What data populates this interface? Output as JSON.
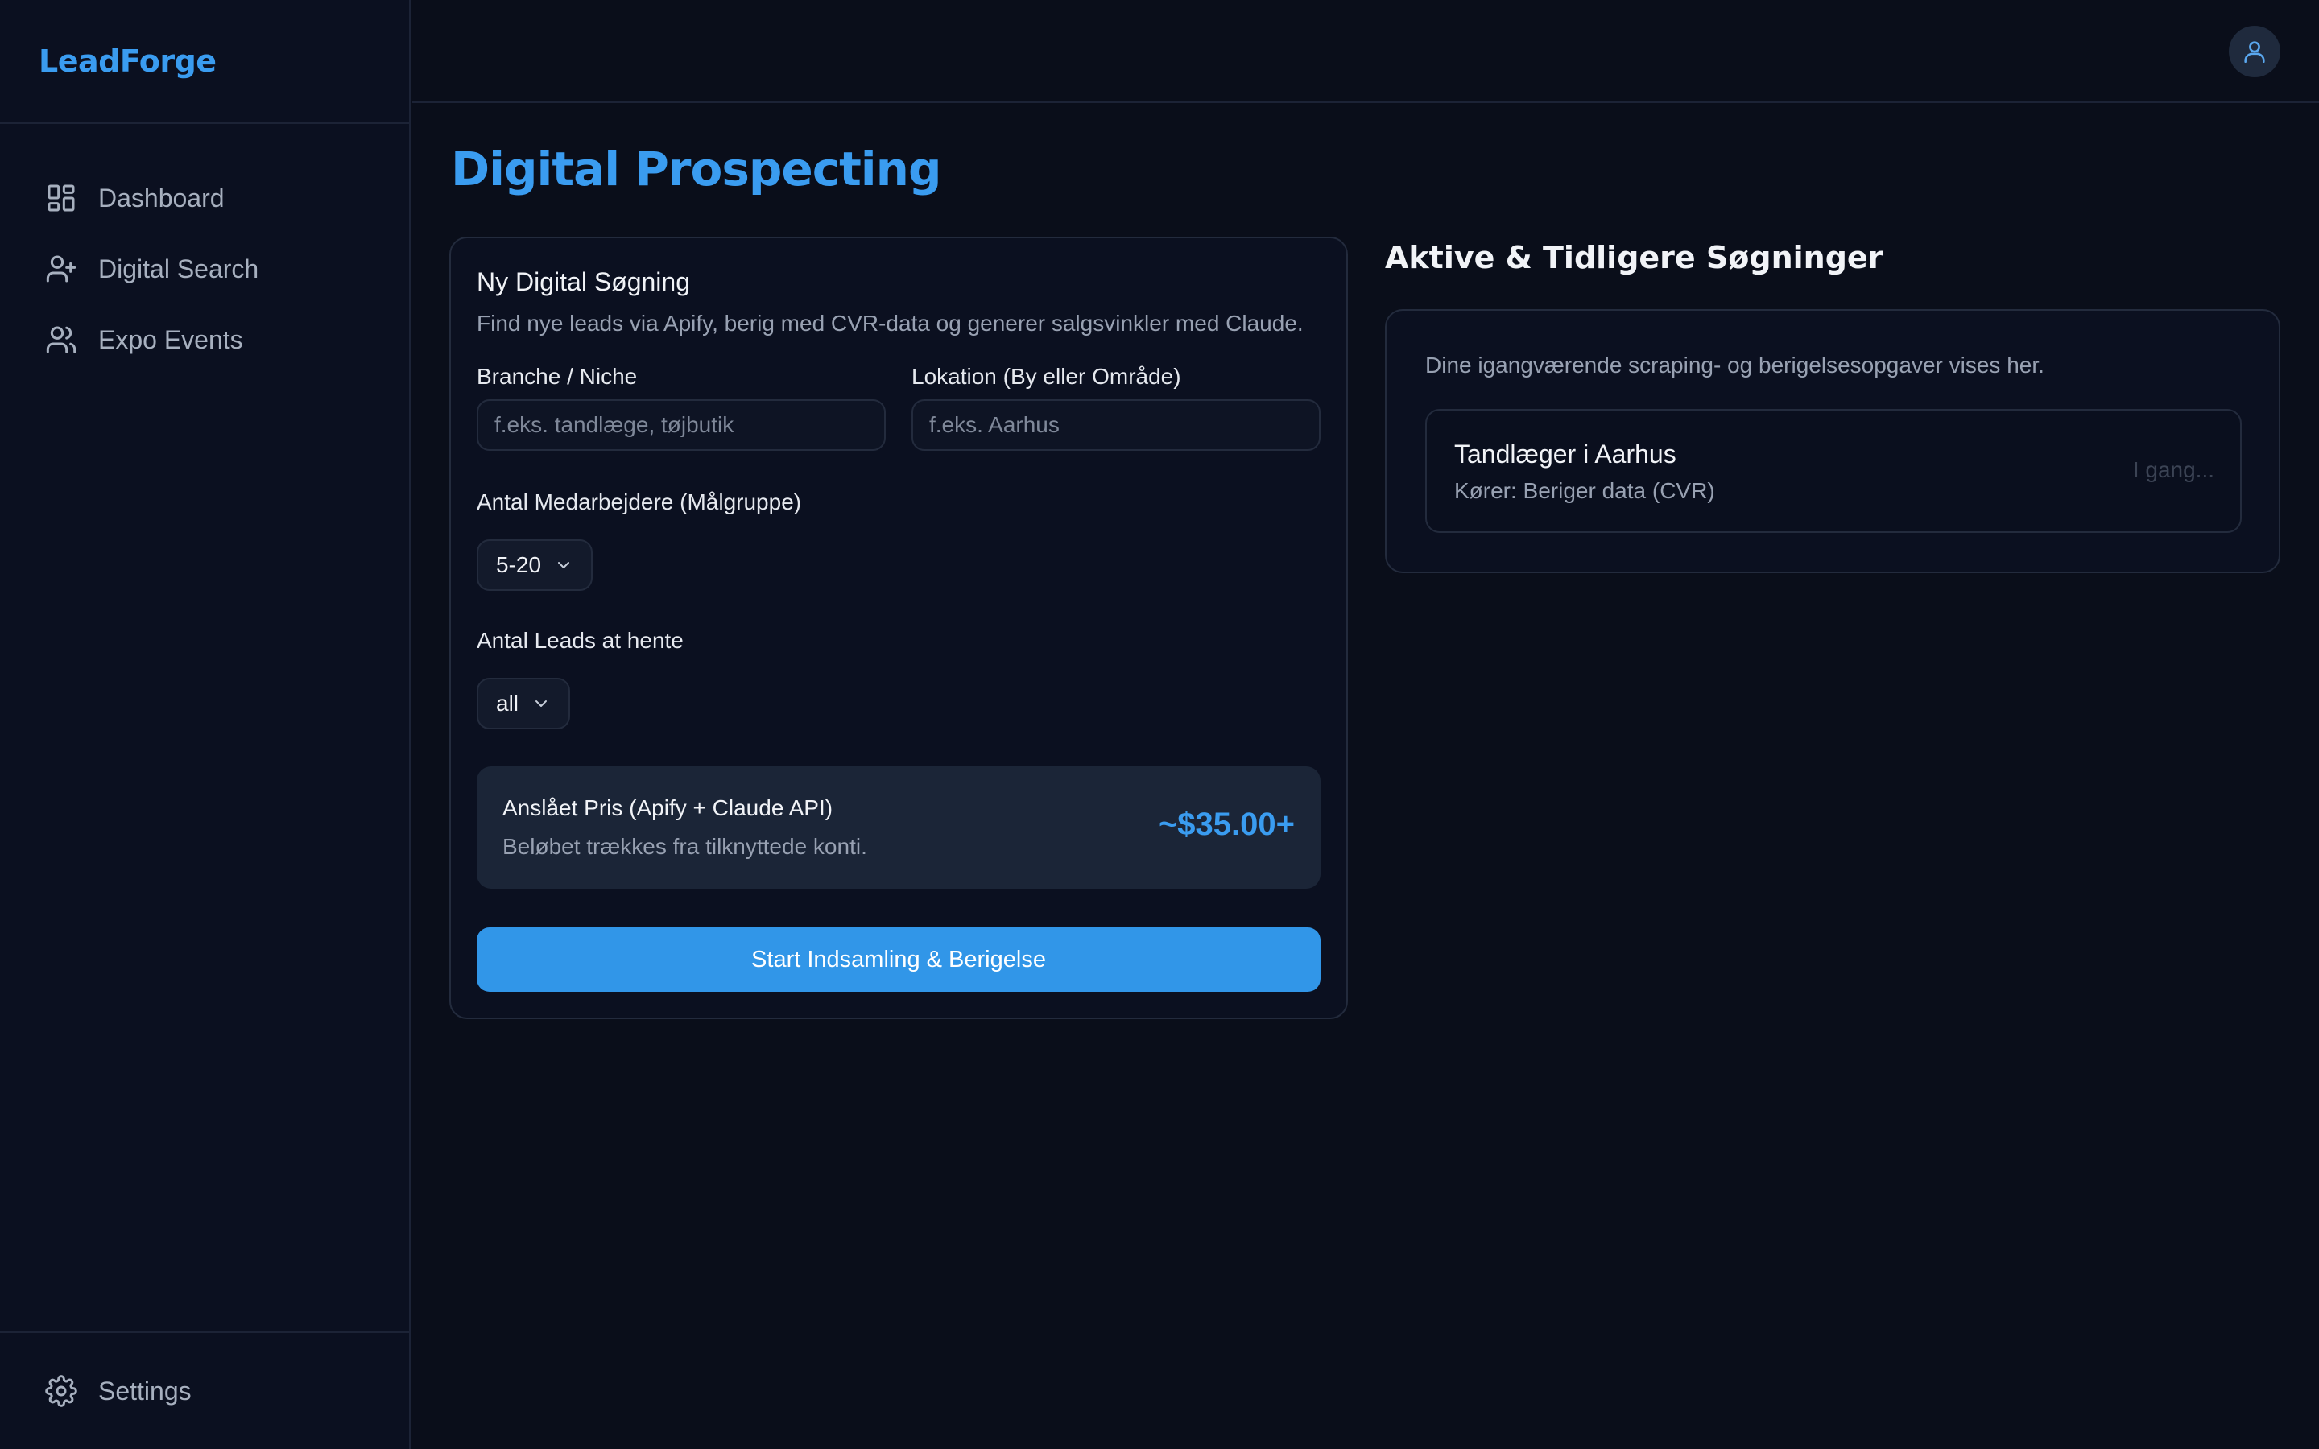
{
  "app": {
    "brand": "LeadForge"
  },
  "sidebar": {
    "items": [
      {
        "label": "Dashboard",
        "icon": "dashboard-icon"
      },
      {
        "label": "Digital Search",
        "icon": "user-plus-icon"
      },
      {
        "label": "Expo Events",
        "icon": "users-icon"
      }
    ],
    "settings": {
      "label": "Settings",
      "icon": "gear-icon"
    }
  },
  "header": {
    "avatar_icon": "user-icon"
  },
  "page": {
    "title": "Digital Prospecting"
  },
  "form": {
    "title": "Ny Digital Søgning",
    "description": "Find nye leads via Apify, berig med CVR-data og generer salgsvinkler med Claude.",
    "niche": {
      "label": "Branche / Niche",
      "placeholder": "f.eks. tandlæge, tøjbutik",
      "value": ""
    },
    "location": {
      "label": "Lokation (By eller Område)",
      "placeholder": "f.eks. Aarhus",
      "value": ""
    },
    "employees": {
      "label": "Antal Medarbejdere (Målgruppe)",
      "value": "5-20"
    },
    "leads": {
      "label": "Antal Leads at hente",
      "value": "all"
    },
    "price": {
      "title": "Anslået Pris (Apify + Claude API)",
      "subtitle": "Beløbet trækkes fra tilknyttede konti.",
      "value": "~$35.00+"
    },
    "submit_label": "Start Indsamling & Berigelse"
  },
  "searches": {
    "title": "Aktive & Tidligere Søgninger",
    "description": "Dine igangværende scraping- og berigelsesopgaver vises her.",
    "jobs": [
      {
        "title": "Tandlæger i Aarhus",
        "subtitle": "Kører: Beriger data (CVR)",
        "status": "I gang..."
      }
    ]
  },
  "colors": {
    "accent": "#3a9cf0",
    "background": "#0a0e1a",
    "button": "#3196e8"
  }
}
